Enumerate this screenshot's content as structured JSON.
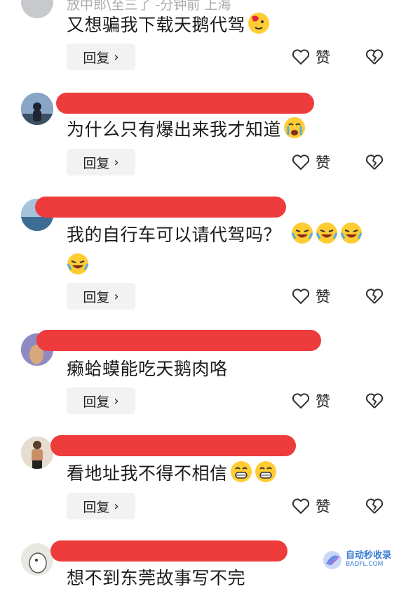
{
  "comments": [
    {
      "partial_header": "放中郎\\至三了 -分钟前 上海",
      "text": "又想骗我下载天鹅代驾",
      "reply_label": "回复",
      "like_label": "赞"
    },
    {
      "text": "为什么只有爆出来我才知道",
      "reply_label": "回复",
      "like_label": "赞"
    },
    {
      "text": "我的自行车可以请代驾吗？",
      "reply_label": "回复",
      "like_label": "赞"
    },
    {
      "text": "癞蛤蟆能吃天鹅肉咯",
      "reply_label": "回复",
      "like_label": "赞"
    },
    {
      "text": "看地址我不得不相信",
      "reply_label": "回复",
      "like_label": "赞"
    },
    {
      "text": "想不到东莞故事写不完"
    }
  ],
  "icons": {
    "chevron": "chevron-right-icon",
    "like": "heart-icon",
    "dislike": "broken-heart-icon"
  },
  "watermark": {
    "line1": "自动秒收录",
    "line2": "BADFL.COM"
  },
  "colors": {
    "redaction": "#ee3b3b",
    "reply_bg": "#f2f2f2"
  }
}
